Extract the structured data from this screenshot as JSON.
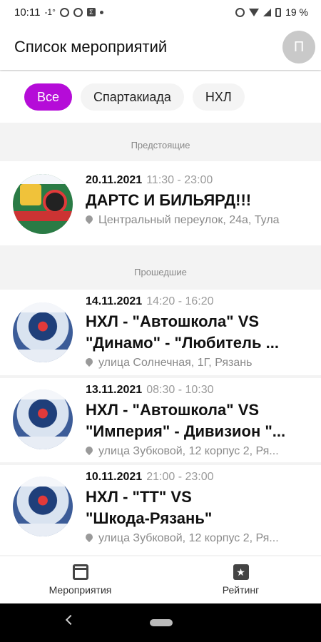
{
  "status": {
    "time": "10:11",
    "temp": "-1°",
    "battery": "19 %"
  },
  "header": {
    "title": "Список мероприятий",
    "avatar_letter": "П"
  },
  "filters": [
    "Все",
    "Спартакиада",
    "НХЛ"
  ],
  "sections": {
    "upcoming": "Предстоящие",
    "past": "Прошедшие"
  },
  "events": [
    {
      "date": "20.11.2021",
      "time": "11:30 - 23:00",
      "title_lines": [
        "ДАРТС И БИЛЬЯРД!!!"
      ],
      "location": "Центральный переулок, 24а, Тула"
    },
    {
      "date": "14.11.2021",
      "time": "14:20 - 16:20",
      "title_lines": [
        "НХЛ - \"Автошкола\" VS",
        "\"Динамо\" - \"Любитель ..."
      ],
      "location": "улица Солнечная, 1Г, Рязань"
    },
    {
      "date": "13.11.2021",
      "time": "08:30 - 10:30",
      "title_lines": [
        "НХЛ - \"Автошкола\" VS",
        "\"Империя\" - Дивизион \"..."
      ],
      "location": "улица Зубковой, 12 корпус 2, Ря..."
    },
    {
      "date": "10.11.2021",
      "time": "21:00 - 23:00",
      "title_lines": [
        "НХЛ - \"ТТ\" VS",
        "\"Шкода-Рязань\""
      ],
      "location": "улица Зубковой, 12 корпус 2, Ря..."
    }
  ],
  "nav": {
    "events": "Мероприятия",
    "rating": "Рейтинг"
  },
  "icons": {
    "events": "calendar-icon",
    "rating": "star-icon",
    "location": "location-pin-icon"
  },
  "colors": {
    "accent": "#b50cd8"
  }
}
